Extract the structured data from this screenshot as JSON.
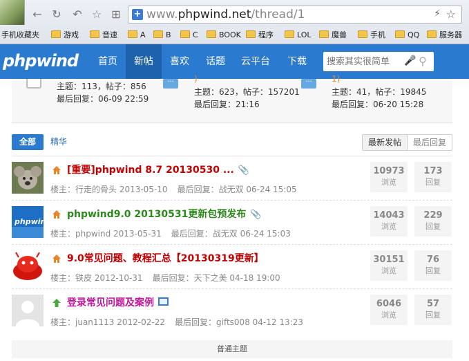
{
  "browser": {
    "url_prefix": "www.",
    "url_host": "phpwind.net",
    "url_path": "/thread/1",
    "bookmarks": [
      "手机收藏夹",
      "游戏",
      "音速",
      "A",
      "B",
      "C",
      "BOOK",
      "程序",
      "LOL",
      "魔兽",
      "手机",
      "QQ",
      "服务器"
    ]
  },
  "nav": {
    "logo": "phpwind",
    "items": [
      "首页",
      "新帖",
      "喜欢",
      "话题",
      "云平台",
      "下载"
    ],
    "active": "新帖",
    "search_placeholder": "搜索其实很简单"
  },
  "stats": [
    {
      "line0": "",
      "line1": "主题：113，帖子：856",
      "line2": "最后回复：06-09 22:59"
    },
    {
      "line0": ")",
      "line1": "主题：623，帖子：157201",
      "line2": "最后回复：21:16"
    },
    {
      "line0": "1)",
      "line1": "主题：41，帖子：19845",
      "line2": "最后回复：06-20 15:28"
    }
  ],
  "tabs": {
    "all": "全部",
    "digest": "精华",
    "sort_new": "最新发帖",
    "sort_reply": "最后回复"
  },
  "threads": [
    {
      "title": "[重要]phpwind 8.7 20130530 ...",
      "color": "#c40000",
      "icon_color": "#e8842a",
      "author": "楼主：行走的骨头 2013-05-10",
      "last": "最后回复：战无双 06-24 15:05",
      "views": "10973",
      "views_label": "浏览",
      "replies": "173",
      "replies_label": "回复"
    },
    {
      "title": "phpwind9.0 20130531更新包预发布",
      "color": "#2b8a1b",
      "icon_color": "#e8842a",
      "author": "楼主：phpwind 2013-05-31",
      "last": "最后回复：战无双 06-24 15:03",
      "views": "14043",
      "views_label": "浏览",
      "replies": "229",
      "replies_label": "回复"
    },
    {
      "title": "9.0常见问题、教程汇总【20130319更新】",
      "color": "#c40000",
      "icon_color": "#e8842a",
      "author": "楼主：铁皮 2012-10-31",
      "last": "最后回复：天下之美 04-18 19:00",
      "views": "30151",
      "views_label": "浏览",
      "replies": "76",
      "replies_label": "回复"
    },
    {
      "title": "登录常见问题及案例",
      "color": "#c0169a",
      "icon_color": "#4aa83a",
      "author": "楼主：juan1113 2012-02-22",
      "last": "最后回复：gifts008 04-12 13:23",
      "views": "6046",
      "views_label": "浏览",
      "replies": "57",
      "replies_label": "回复"
    }
  ],
  "footer_label": "普通主题"
}
